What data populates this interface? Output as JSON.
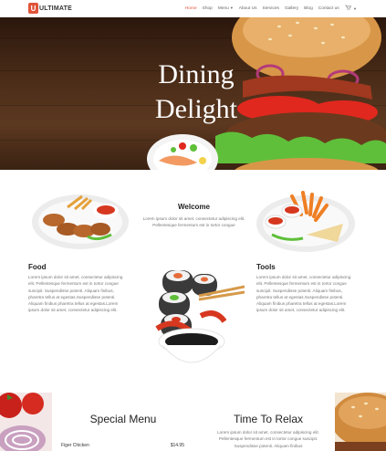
{
  "brand": {
    "logo_letter": "U",
    "name": "ULTIMATE",
    "accent": "#e0543a"
  },
  "nav": {
    "items": [
      "Home",
      "Shop",
      "Menu",
      "About Us",
      "Services",
      "Gallery",
      "Blog",
      "Contact us"
    ],
    "active": "Home",
    "cart_icon": "cart-icon"
  },
  "hero": {
    "title_line1": "Dining",
    "title_line2": "Delight"
  },
  "welcome": {
    "title": "Welcome",
    "text": "Lorem ipsum dolor sit amet, consectetur adipiscing elit. Pellentesque fermentum est in tortor congue"
  },
  "food": {
    "title": "Food",
    "text": "Lorem ipsum dolor sit amet, consectetur adipiscing elit. Pellentesque fermentum est in tortor congue suscipit. Suspendisse potenti. Aliquam finibus, pharetra tellus at egestas.Suspendisse potenti. Aliquam finibus pharetra tellus at egestas.Lorem ipsum dolor sit amet, consectetur adipiscing elit."
  },
  "tools": {
    "title": "Tools",
    "text": "Lorem ipsum dolor sit amet, consectetur adipiscing elit. Pellentesque fermentum est in tortor congue suscipit. Suspendisse potenti. Aliquam finibus, pharetra tellus at egestas.Suspendisse potenti. Aliquam finibus pharetra tellus at egestas.Lorem ipsum dolor sit amet, consectetur adipiscing elit."
  },
  "special_menu": {
    "title": "Special Menu",
    "items": [
      {
        "name": "Figer Chicken",
        "price": "$14.95"
      }
    ]
  },
  "relax": {
    "title": "Time To Relax",
    "text": "Lorem ipsum dolor sit amet, consectetur adipiscing elit. Pellentesque fermentum est in tortor congue suscipit. Suspendisse potenti. Aliquam finibus"
  }
}
